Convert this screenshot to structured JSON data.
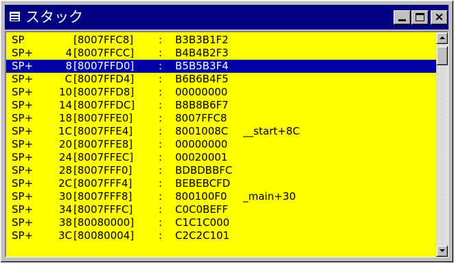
{
  "window": {
    "title": "スタック",
    "icon": "list-window-icon",
    "buttons": {
      "minimize": "minimize-icon",
      "maximize": "maximize-icon",
      "close_glyph": "×"
    }
  },
  "colors": {
    "titlebar": "#000080",
    "list_background": "#ffff00",
    "selection_background": "#0000a8",
    "selection_text": "#ffffff",
    "text": "#000000"
  },
  "stack": {
    "selected_index": 2,
    "rows": [
      {
        "sp": "SP",
        "offset": "",
        "address": "[8007FFC8]",
        "colon": ":",
        "value": "B3B3B1F2",
        "symbol": ""
      },
      {
        "sp": "SP+",
        "offset": "4",
        "address": "[8007FFCC]",
        "colon": ":",
        "value": "B4B4B2F3",
        "symbol": ""
      },
      {
        "sp": "SP+",
        "offset": "8",
        "address": "[8007FFD0]",
        "colon": ":",
        "value": "B5B5B3F4",
        "symbol": ""
      },
      {
        "sp": "SP+",
        "offset": "C",
        "address": "[8007FFD4]",
        "colon": ":",
        "value": "B6B6B4F5",
        "symbol": ""
      },
      {
        "sp": "SP+",
        "offset": "10",
        "address": "[8007FFD8]",
        "colon": ":",
        "value": "00000000",
        "symbol": ""
      },
      {
        "sp": "SP+",
        "offset": "14",
        "address": "[8007FFDC]",
        "colon": ":",
        "value": "B8B8B6F7",
        "symbol": ""
      },
      {
        "sp": "SP+",
        "offset": "18",
        "address": "[8007FFE0]",
        "colon": ":",
        "value": "8007FFC8",
        "symbol": ""
      },
      {
        "sp": "SP+",
        "offset": "1C",
        "address": "[8007FFE4]",
        "colon": ":",
        "value": "8001008C",
        "symbol": "__start+8C"
      },
      {
        "sp": "SP+",
        "offset": "20",
        "address": "[8007FFE8]",
        "colon": ":",
        "value": "00000000",
        "symbol": ""
      },
      {
        "sp": "SP+",
        "offset": "24",
        "address": "[8007FFEC]",
        "colon": ":",
        "value": "00020001",
        "symbol": ""
      },
      {
        "sp": "SP+",
        "offset": "28",
        "address": "[8007FFF0]",
        "colon": ":",
        "value": "BDBDBBFC",
        "symbol": ""
      },
      {
        "sp": "SP+",
        "offset": "2C",
        "address": "[8007FFF4]",
        "colon": ":",
        "value": "BEBEBCFD",
        "symbol": ""
      },
      {
        "sp": "SP+",
        "offset": "30",
        "address": "[8007FFF8]",
        "colon": ":",
        "value": "800100F0",
        "symbol": "_main+30"
      },
      {
        "sp": "SP+",
        "offset": "34",
        "address": "[8007FFFC]",
        "colon": ":",
        "value": "C0C0BEFF",
        "symbol": ""
      },
      {
        "sp": "SP+",
        "offset": "38",
        "address": "[80080000]",
        "colon": ":",
        "value": "C1C1C000",
        "symbol": ""
      },
      {
        "sp": "SP+",
        "offset": "3C",
        "address": "[80080004]",
        "colon": ":",
        "value": "C2C2C101",
        "symbol": ""
      }
    ]
  },
  "scrollbar": {
    "up_icon": "scroll-up-arrow-icon",
    "down_icon": "scroll-down-arrow-icon"
  }
}
